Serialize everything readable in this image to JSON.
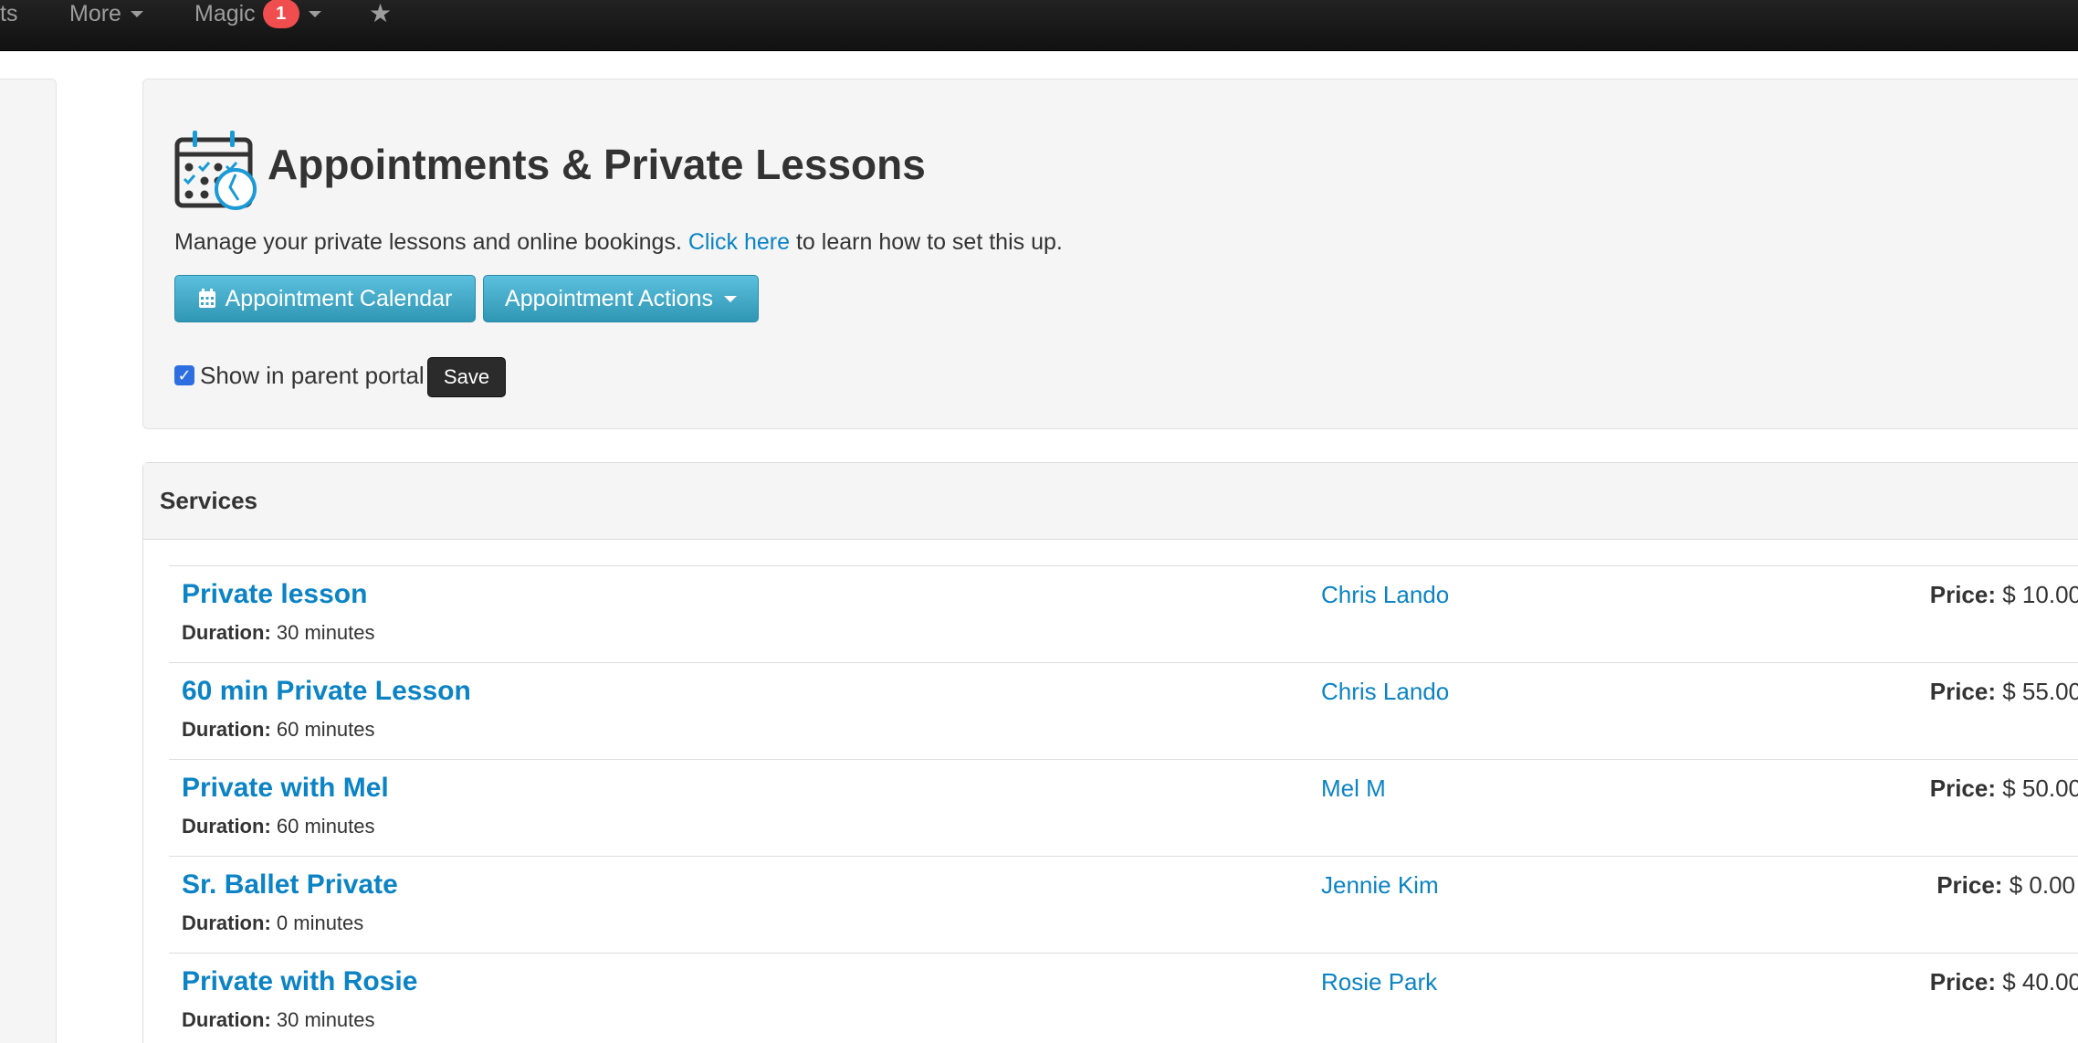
{
  "navbar": {
    "partial_item": "ts",
    "more_label": "More",
    "magic_label": "Magic",
    "magic_badge": "1",
    "star_icon": "star-icon"
  },
  "header": {
    "title": "Appointments & Private Lessons",
    "subtitle_before": "Manage your private lessons and online bookings.",
    "subtitle_link": "Click here",
    "subtitle_after": "to learn how to set this up.",
    "calendar_button": "Appointment Calendar",
    "actions_button": "Appointment Actions",
    "portal_checkbox_label": "Show in parent portal",
    "portal_checked": true,
    "save_button": "Save"
  },
  "services": {
    "heading": "Services",
    "duration_label": "Duration:",
    "price_label": "Price:",
    "items": [
      {
        "name": "Private lesson",
        "duration": "30 minutes",
        "staff": "Chris Lando",
        "price": "$ 10.00"
      },
      {
        "name": "60 min Private Lesson",
        "duration": "60 minutes",
        "staff": "Chris Lando",
        "price": "$ 55.00"
      },
      {
        "name": "Private with Mel",
        "duration": "60 minutes",
        "staff": "Mel M",
        "price": "$ 50.00"
      },
      {
        "name": "Sr. Ballet Private",
        "duration": "0 minutes",
        "staff": "Jennie Kim",
        "price": "$ 0.00"
      },
      {
        "name": "Private with Rosie",
        "duration": "30 minutes",
        "staff": "Rosie Park",
        "price": "$ 40.00"
      }
    ]
  },
  "colors": {
    "link": "#0b83c4",
    "info_button": "#2f96b4",
    "badge": "#f04e4e",
    "navbar": "#111111"
  }
}
